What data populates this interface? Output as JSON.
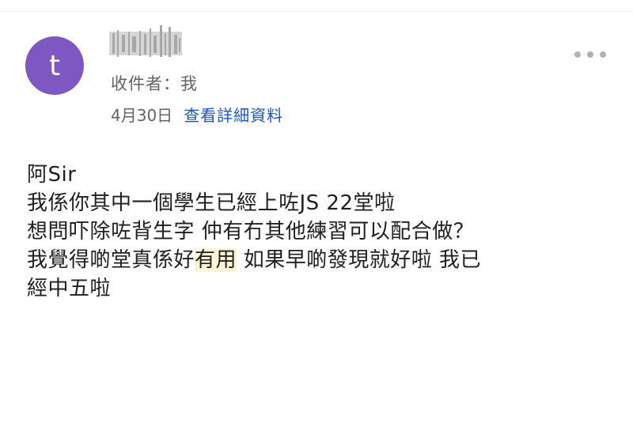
{
  "colors": {
    "avatar_bg": "#7e57c2",
    "link": "#1a56b8",
    "meta_text": "#5f6368",
    "body_text": "#1f1f1f",
    "highlight": "#fdf6d6"
  },
  "email": {
    "avatar_letter": "t",
    "sender_name": "",
    "recipient_label": "收件者：我",
    "date": "4月30日",
    "details_link": "查看詳細資料",
    "more_icon": "more-horizontal-icon",
    "body": {
      "line1": "阿Sir",
      "line2": "我係你其中一個學生已經上咗JS 22堂啦",
      "line3": "想問吓除咗背生字 仲有冇其他練習可以配合做？",
      "line4_before": "我覺得啲堂真係好",
      "line4_highlight": "有用",
      "line4_after": " 如果早啲發現就好啦 我已",
      "line5": "經中五啦"
    }
  }
}
